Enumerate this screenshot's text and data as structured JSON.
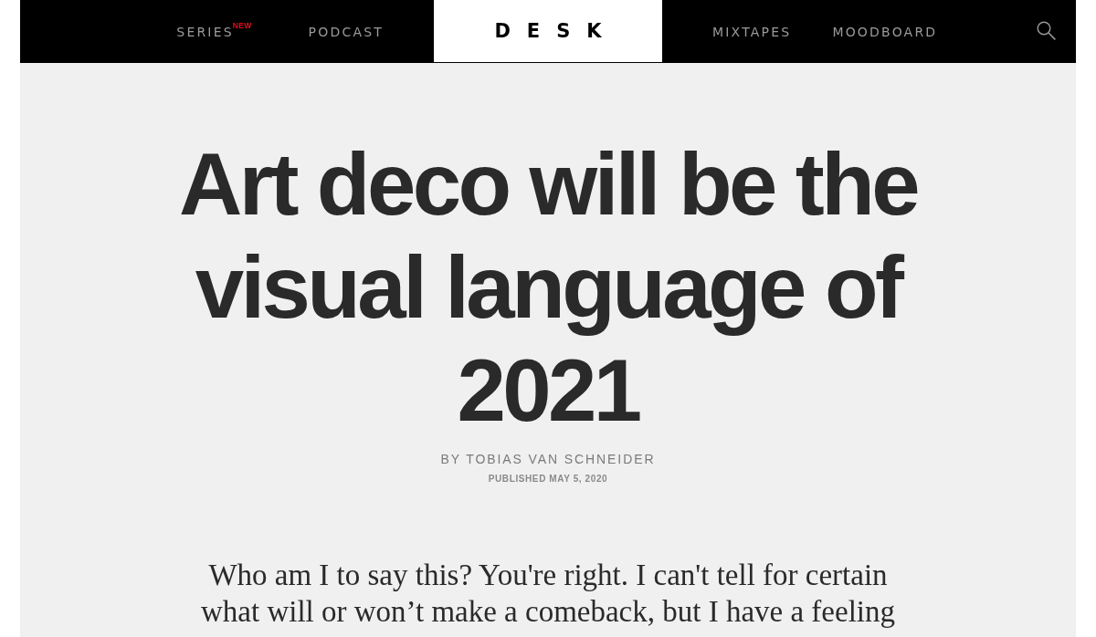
{
  "nav": {
    "left_links": [
      {
        "label": "SERIES",
        "badge": "NEW"
      },
      {
        "label": "PODCAST"
      }
    ],
    "logo": "DESK",
    "right_links": [
      {
        "label": "MIXTAPES"
      },
      {
        "label": "MOODBOARD"
      }
    ]
  },
  "article": {
    "title": "Art deco will be the visual language of 2021",
    "byline": "BY TOBIAS VAN SCHNEIDER",
    "published": "PUBLISHED MAY 5, 2020",
    "intro_lines": [
      "Who am I to say this? You're right. I can't tell for certain",
      "what will or won’t make a comeback, but I have a feeling"
    ]
  }
}
